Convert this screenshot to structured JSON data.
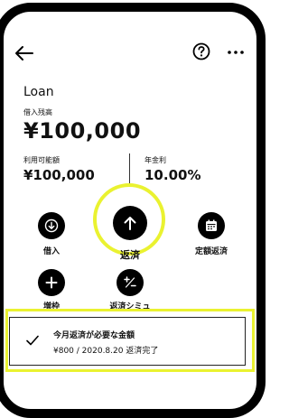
{
  "header": {
    "back_icon": "arrow-left-icon",
    "help_icon": "question-circle-icon",
    "more_icon": "more-horizontal-icon"
  },
  "loan": {
    "title": "Loan",
    "balance_label": "借入残高",
    "balance_value": "¥100,000",
    "available_label": "利用可能額",
    "available_value": "¥100,000",
    "rate_label": "年金利",
    "rate_value": "10.00%"
  },
  "actions": {
    "borrow_label": "借入",
    "repay_label": "返済",
    "scheduled_label": "定額返済",
    "increase_label": "増枠",
    "simulation_label": "返済シミュ"
  },
  "notice": {
    "title": "今月返済が必要な金額",
    "detail": "¥800 / 2020.8.20 返済完了"
  },
  "colors": {
    "highlight": "#eaf230",
    "button": "#000000",
    "background": "#ffffff"
  }
}
